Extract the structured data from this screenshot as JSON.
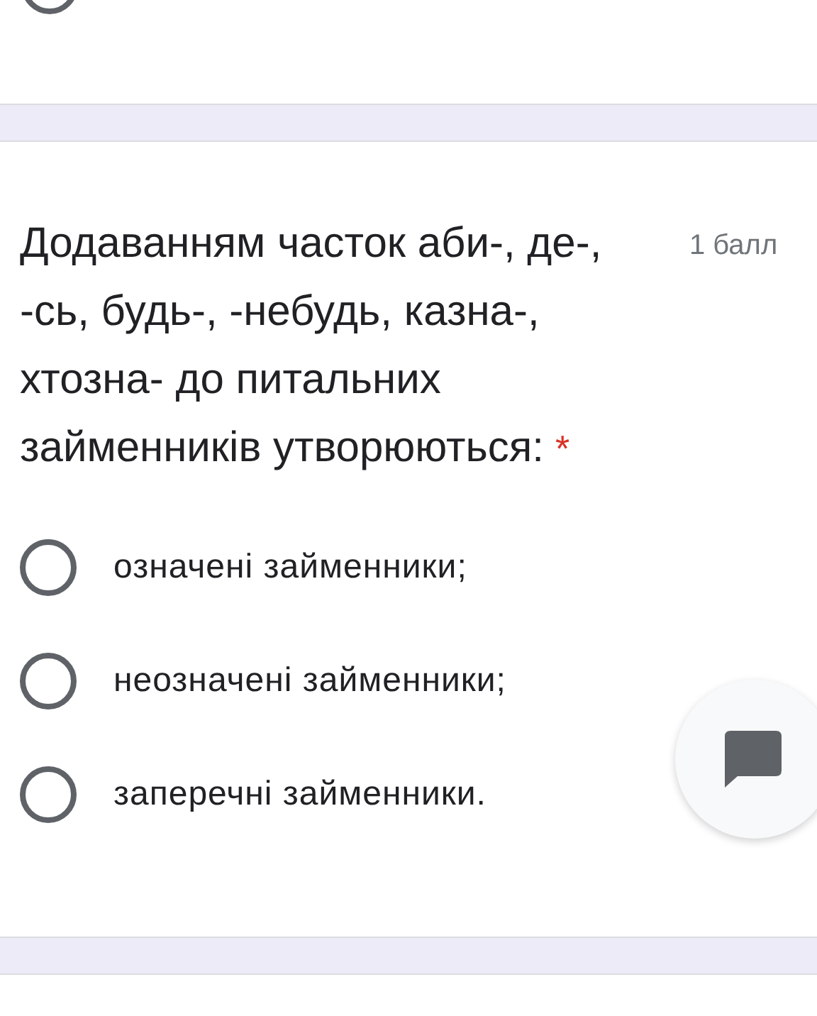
{
  "previous_question": {
    "options": [
      {
        "selected": false
      }
    ]
  },
  "question": {
    "text": "Додаванням часток аби-, де-, -сь, будь-, -небудь, казна-, хтозна- до питальних займенників утворюються:",
    "required_mark": "*",
    "points": "1 балл",
    "options": [
      {
        "label": "означені займенники;",
        "selected": false
      },
      {
        "label": "неозначені займенники;",
        "selected": false
      },
      {
        "label": "заперечні займенники.",
        "selected": false
      }
    ]
  }
}
